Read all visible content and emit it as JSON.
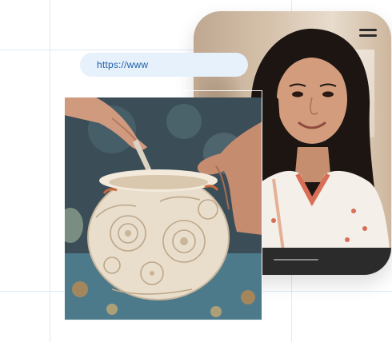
{
  "address_bar": {
    "url": "https://www"
  },
  "phone": {
    "menu_icon": "hamburger-menu-icon"
  },
  "images": {
    "portrait": "young-woman-smiling-portrait",
    "pottery": "hands-carving-ceramic-pot"
  },
  "colors": {
    "url_bar_bg": "#e7f1fb",
    "url_text": "#1f5fa8",
    "phone_footer": "#2b2b2b",
    "grid_line": "#d9e8f7"
  }
}
